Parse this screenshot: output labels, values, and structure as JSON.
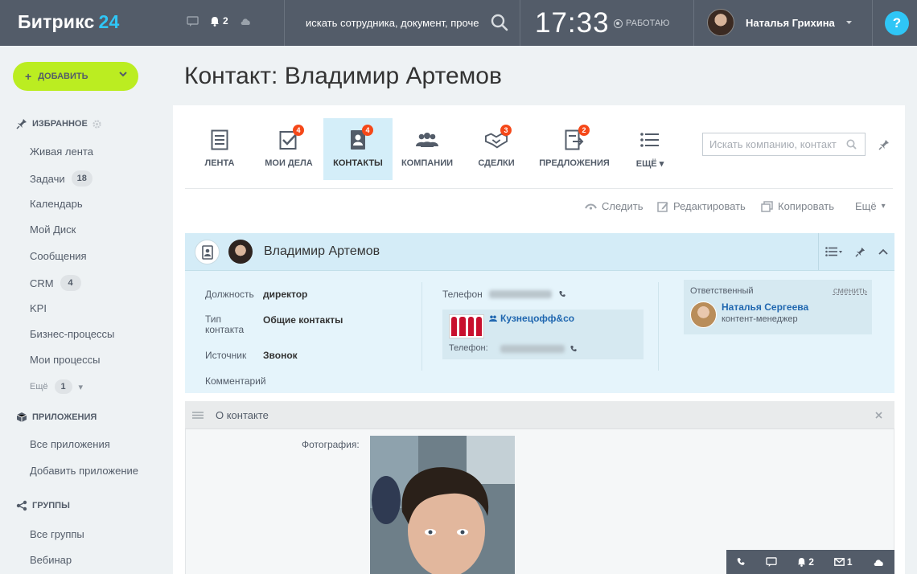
{
  "header": {
    "logo_text": "Битрикс",
    "logo_num": "24",
    "notifications_count": "2",
    "search_placeholder": "искать сотрудника, документ, проче",
    "time": "17:33",
    "status": "РАБОТАЮ",
    "user_name": "Наталья Грихина",
    "help": "?"
  },
  "sidebar": {
    "add_button": "ДОБАВИТЬ",
    "favorites_title": "ИЗБРАННОЕ",
    "items": [
      {
        "label": "Живая лента",
        "count": ""
      },
      {
        "label": "Задачи",
        "count": "18"
      },
      {
        "label": "Календарь",
        "count": ""
      },
      {
        "label": "Мой Диск",
        "count": ""
      },
      {
        "label": "Сообщения",
        "count": ""
      },
      {
        "label": "CRM",
        "count": "4"
      },
      {
        "label": "KPI",
        "count": ""
      },
      {
        "label": "Бизнес-процессы",
        "count": ""
      },
      {
        "label": "Мои процессы",
        "count": ""
      }
    ],
    "more_label": "Ещё",
    "more_count": "1",
    "apps_title": "ПРИЛОЖЕНИЯ",
    "apps_items": [
      "Все приложения",
      "Добавить приложение"
    ],
    "groups_title": "ГРУППЫ",
    "groups_items": [
      "Все группы",
      "Вебинар"
    ]
  },
  "page": {
    "title": "Контакт: Владимир Артемов"
  },
  "tabs": [
    {
      "label": "ЛЕНТА",
      "badge": ""
    },
    {
      "label": "МОИ ДЕЛА",
      "badge": "4"
    },
    {
      "label": "КОНТАКТЫ",
      "badge": "4"
    },
    {
      "label": "КОМПАНИИ",
      "badge": ""
    },
    {
      "label": "СДЕЛКИ",
      "badge": "3"
    },
    {
      "label": "ПРЕДЛОЖЕНИЯ",
      "badge": "2"
    },
    {
      "label": "ЕЩЁ",
      "badge": ""
    }
  ],
  "crm_search_placeholder": "Искать компанию, контакт",
  "actions": {
    "follow": "Следить",
    "edit": "Редактировать",
    "copy": "Копировать",
    "more": "Ещё"
  },
  "contact": {
    "name": "Владимир Артемов",
    "position_label": "Должность",
    "position_value": "директор",
    "type_label": "Тип контакта",
    "type_value": "Общие контакты",
    "source_label": "Источник",
    "source_value": "Звонок",
    "comment_label": "Комментарий",
    "phone_label": "Телефон",
    "company_name": "Кузнецофф&co",
    "company_phone_label": "Телефон:",
    "responsible_label": "Ответственный",
    "responsible_change": "сменить",
    "responsible_name": "Наталья Сергеева",
    "responsible_role": "контент-менеджер"
  },
  "about": {
    "title": "О контакте",
    "photo_label": "Фотография:"
  },
  "bottom_bar": {
    "notifications": "2",
    "messages": "1"
  },
  "colors": {
    "header_bg": "#535c69",
    "accent_blue": "#2fc6f6",
    "add_green": "#bbed21",
    "badge_red": "#f54819",
    "active_tab": "#d4eef9"
  }
}
